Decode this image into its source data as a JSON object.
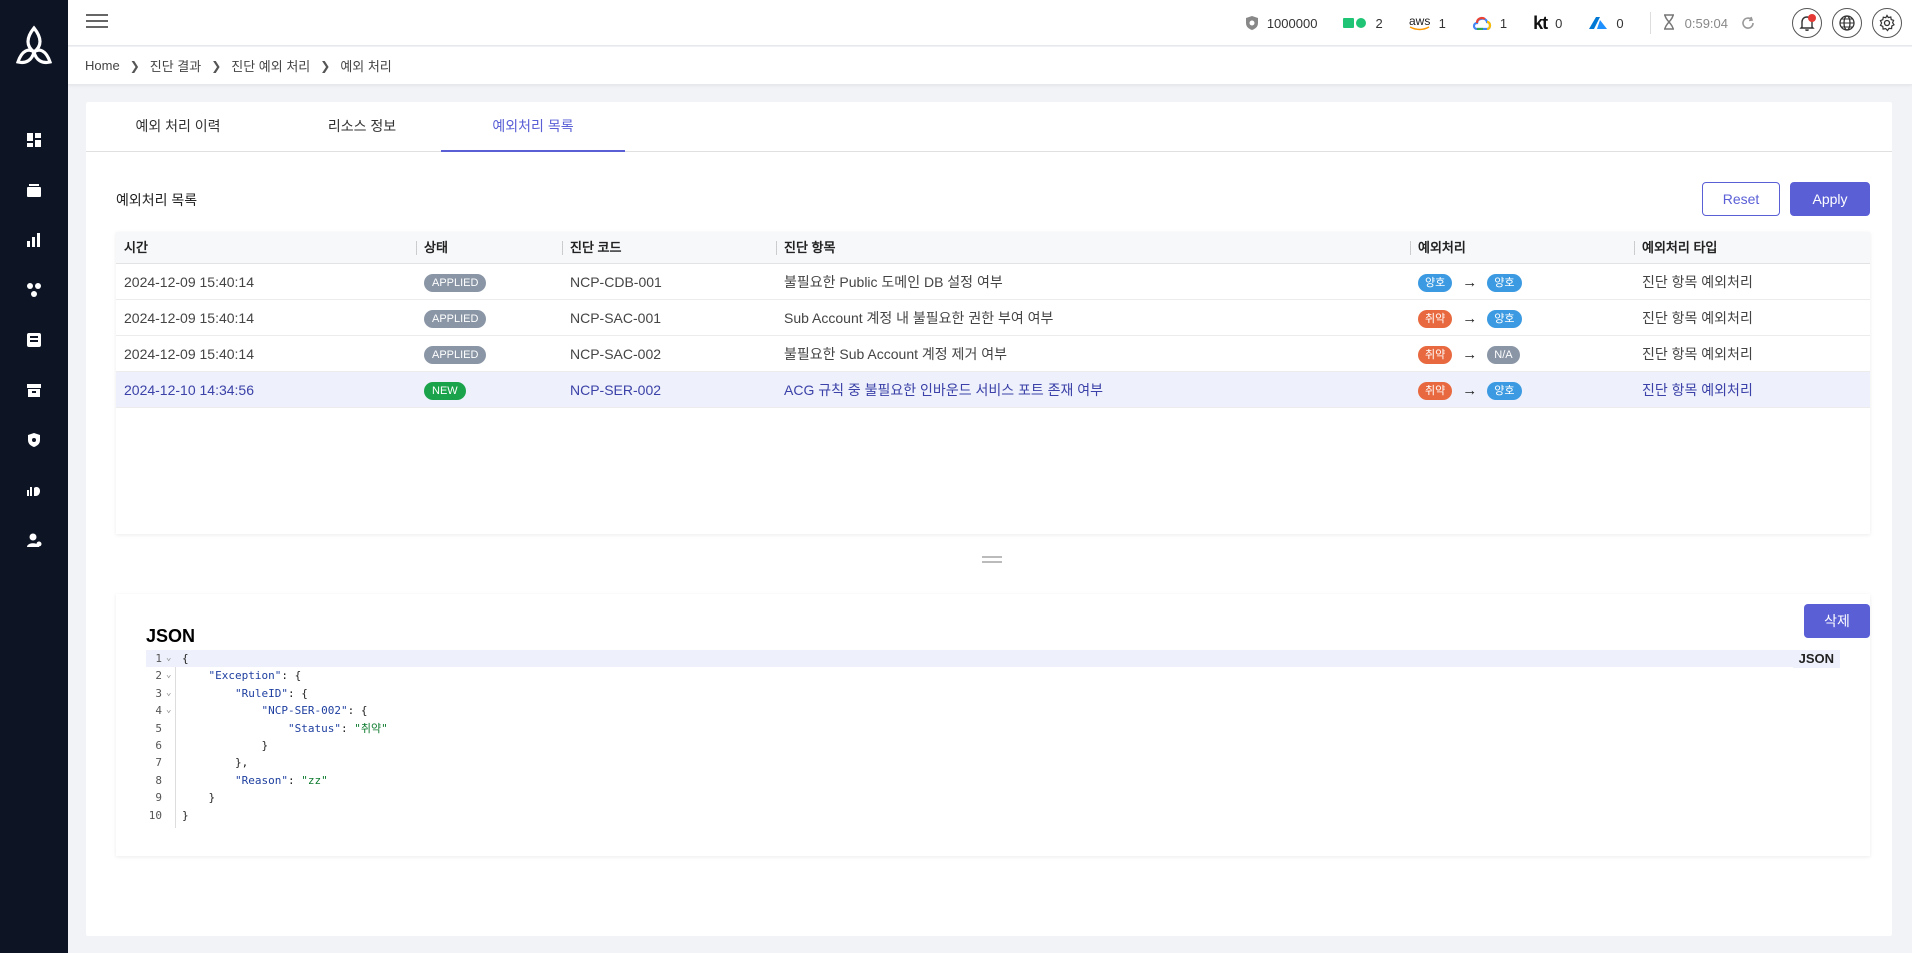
{
  "topbar": {
    "stats": [
      {
        "icon": "shield-icon",
        "value": "1000000"
      },
      {
        "icon": "ncp-icon",
        "value": "2"
      },
      {
        "icon": "aws-icon",
        "label": "aws",
        "value": "1"
      },
      {
        "icon": "gcp-icon",
        "value": "1"
      },
      {
        "icon": "kt-icon",
        "label": "kt",
        "value": "0"
      },
      {
        "icon": "azure-icon",
        "value": "0"
      }
    ],
    "timer": "0:59:04"
  },
  "breadcrumb": [
    "Home",
    "진단 결과",
    "진단 예외 처리",
    "예외 처리"
  ],
  "tabs": [
    {
      "label": "예외 처리 이력"
    },
    {
      "label": "리소스 정보"
    },
    {
      "label": "예외처리 목록"
    }
  ],
  "section": {
    "title": "예외처리 목록",
    "reset_label": "Reset",
    "apply_label": "Apply"
  },
  "table": {
    "columns": [
      "시간",
      "상태",
      "진단 코드",
      "진단 항목",
      "예외처리",
      "예외처리 타입"
    ],
    "rows": [
      {
        "time": "2024-12-09 15:40:14",
        "status": "APPLIED",
        "code": "NCP-CDB-001",
        "item": "불필요한 Public 도메인 DB 설정 여부",
        "from": "양호",
        "to": "양호",
        "type": "진단 항목 예외처리"
      },
      {
        "time": "2024-12-09 15:40:14",
        "status": "APPLIED",
        "code": "NCP-SAC-001",
        "item": "Sub Account 계정 내 불필요한 권한 부여 여부",
        "from": "취약",
        "to": "양호",
        "type": "진단 항목 예외처리"
      },
      {
        "time": "2024-12-09 15:40:14",
        "status": "APPLIED",
        "code": "NCP-SAC-002",
        "item": "불필요한 Sub Account 계정 제거 여부",
        "from": "취약",
        "to": "N/A",
        "type": "진단 항목 예외처리"
      },
      {
        "time": "2024-12-10 14:34:56",
        "status": "NEW",
        "code": "NCP-SER-002",
        "item": "ACG 규칙 중 불필요한 인바운드 서비스 포트 존재 여부",
        "from": "취약",
        "to": "양호",
        "type": "진단 항목 예외처리"
      }
    ]
  },
  "json_panel": {
    "title": "JSON",
    "delete_label": "삭제",
    "lang_label": "JSON",
    "lines": [
      "1",
      "2",
      "3",
      "4",
      "5",
      "6",
      "7",
      "8",
      "9",
      "10"
    ],
    "keys": {
      "exception": "\"Exception\"",
      "ruleid": "\"RuleID\"",
      "rule": "\"NCP-SER-002\"",
      "status": "\"Status\"",
      "reason": "\"Reason\""
    },
    "values": {
      "status": "\"취약\"",
      "reason": "\"zz\""
    }
  },
  "colors": {
    "accent": "#5a5fd6",
    "sidebar": "#0d1424",
    "good": "#3b9ae1",
    "weak": "#e8693f",
    "new": "#1aa34a",
    "applied": "#8a96a6"
  }
}
